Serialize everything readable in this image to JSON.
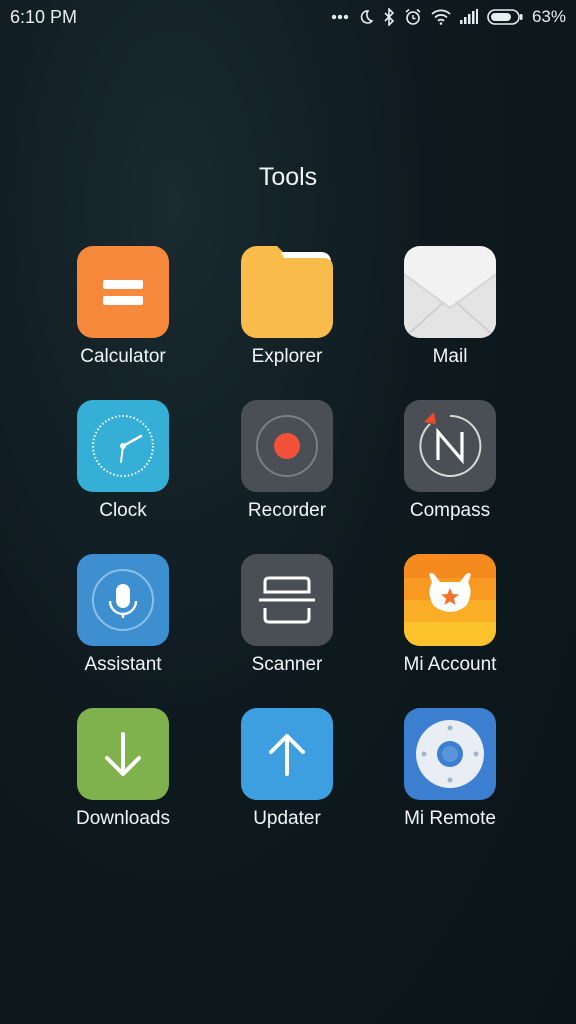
{
  "status_bar": {
    "time": "6:10 PM",
    "battery_percent": "63%",
    "icons": [
      "more-dots-icon",
      "moon-icon",
      "bluetooth-icon",
      "alarm-icon",
      "wifi-icon",
      "signal-icon",
      "battery-icon"
    ],
    "battery_level": 0.63
  },
  "folder": {
    "title": "Tools",
    "apps": [
      {
        "label": "Calculator",
        "icon": "calculator-icon",
        "color": "#F5883A"
      },
      {
        "label": "Explorer",
        "icon": "folder-icon",
        "color": "#F9BB4A"
      },
      {
        "label": "Mail",
        "icon": "mail-envelope-icon",
        "color": "#F2F2F2"
      },
      {
        "label": "Clock",
        "icon": "clock-icon",
        "color": "#35AFD6"
      },
      {
        "label": "Recorder",
        "icon": "recorder-icon",
        "color": "#4A4F55"
      },
      {
        "label": "Compass",
        "icon": "compass-icon",
        "color": "#4A4F55"
      },
      {
        "label": "Assistant",
        "icon": "microphone-icon",
        "color": "#3D8FD0"
      },
      {
        "label": "Scanner",
        "icon": "scanner-icon",
        "color": "#4A4F55"
      },
      {
        "label": "Mi Account",
        "icon": "mi-bunny-icon",
        "color": "#F7A21E"
      },
      {
        "label": "Downloads",
        "icon": "download-arrow-icon",
        "color": "#7FB24D"
      },
      {
        "label": "Updater",
        "icon": "upload-arrow-icon",
        "color": "#3E9FE0"
      },
      {
        "label": "Mi Remote",
        "icon": "remote-dpad-icon",
        "color": "#3C7FD0"
      }
    ]
  }
}
